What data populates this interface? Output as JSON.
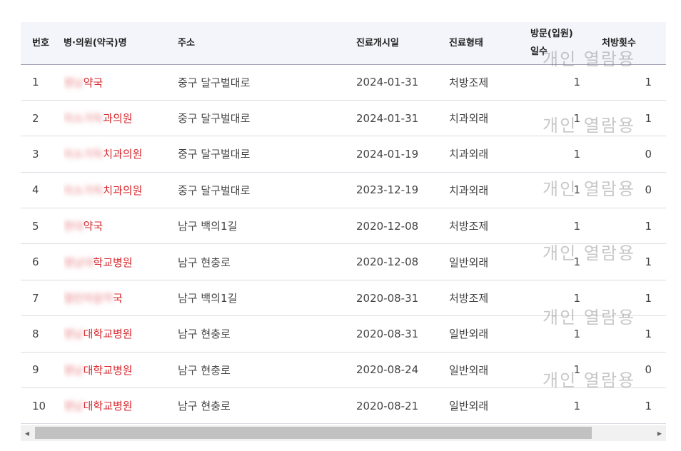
{
  "table": {
    "headers": {
      "no": "번호",
      "name": "병·의원(약국)명",
      "address": "주소",
      "start_date": "진료개시일",
      "type": "진료형태",
      "visit_days_line1": "방문(입원)",
      "visit_days_line2": "일수",
      "prescriptions": "처방횟수"
    },
    "rows": [
      {
        "no": "1",
        "name_blur": "영남",
        "name_visible": "약국",
        "address": "중구 달구벌대로",
        "start_date": "2024-01-31",
        "type": "처방조제",
        "visit_days": "1",
        "prescriptions": "1"
      },
      {
        "no": "2",
        "name_blur": "미소가득",
        "name_visible": "과의원",
        "address": "중구 달구벌대로",
        "start_date": "2024-01-31",
        "type": "치과외래",
        "visit_days": "1",
        "prescriptions": "1"
      },
      {
        "no": "3",
        "name_blur": "미소가득",
        "name_visible": "치과의원",
        "address": "중구 달구벌대로",
        "start_date": "2024-01-19",
        "type": "치과외래",
        "visit_days": "1",
        "prescriptions": "0"
      },
      {
        "no": "4",
        "name_blur": "미소가득",
        "name_visible": "치과의원",
        "address": "중구 달구벌대로",
        "start_date": "2023-12-19",
        "type": "치과외래",
        "visit_days": "1",
        "prescriptions": "0"
      },
      {
        "no": "5",
        "name_blur": "현대",
        "name_visible": "약국",
        "address": "남구 백의1길",
        "start_date": "2020-12-08",
        "type": "처방조제",
        "visit_days": "1",
        "prescriptions": "1"
      },
      {
        "no": "6",
        "name_blur": "영남대",
        "name_visible": "학교병원",
        "address": "남구 현충로",
        "start_date": "2020-12-08",
        "type": "일반외래",
        "visit_days": "1",
        "prescriptions": "1"
      },
      {
        "no": "7",
        "name_blur": "열린마음약",
        "name_visible": "국",
        "address": "남구 백의1길",
        "start_date": "2020-08-31",
        "type": "처방조제",
        "visit_days": "1",
        "prescriptions": "1"
      },
      {
        "no": "8",
        "name_blur": "영남",
        "name_visible": "대학교병원",
        "address": "남구 현충로",
        "start_date": "2020-08-31",
        "type": "일반외래",
        "visit_days": "1",
        "prescriptions": "1"
      },
      {
        "no": "9",
        "name_blur": "영남",
        "name_visible": "대학교병원",
        "address": "남구 현충로",
        "start_date": "2020-08-24",
        "type": "일반외래",
        "visit_days": "1",
        "prescriptions": "0"
      },
      {
        "no": "10",
        "name_blur": "영남",
        "name_visible": "대학교병원",
        "address": "남구 현충로",
        "start_date": "2020-08-21",
        "type": "일반외래",
        "visit_days": "1",
        "prescriptions": "1"
      }
    ]
  },
  "watermark": {
    "text": "개인 열람용"
  },
  "scrollbar": {
    "left_arrow": "◀",
    "right_arrow": "▶"
  },
  "colors": {
    "header_bg": "#f4f5fb",
    "name_red": "#d7262b"
  }
}
